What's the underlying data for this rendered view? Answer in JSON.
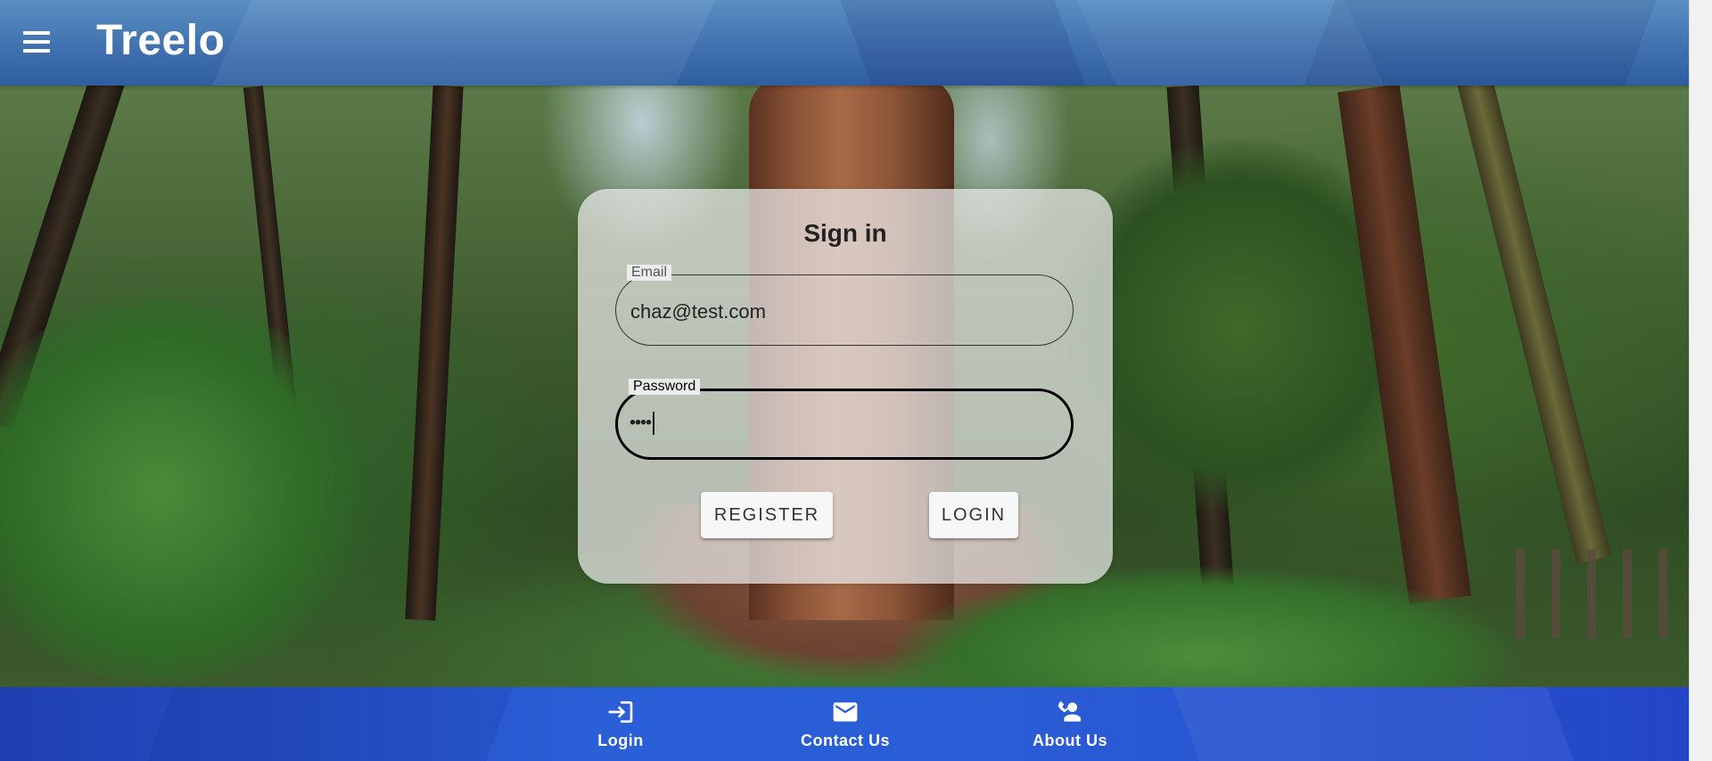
{
  "app": {
    "title": "Treelo"
  },
  "signin": {
    "title": "Sign in",
    "email": {
      "label": "Email",
      "value": "chaz@test.com"
    },
    "password": {
      "label": "Password",
      "value": "••••"
    },
    "register_label": "REGISTER",
    "login_label": "LOGIN"
  },
  "bottom_nav": {
    "items": [
      {
        "label": "Login",
        "icon": "login-icon"
      },
      {
        "label": "Contact Us",
        "icon": "mail-icon"
      },
      {
        "label": "About Us",
        "icon": "contact-phone-icon"
      }
    ]
  },
  "colors": {
    "appbar": "#3f6fae",
    "bottom_nav": "#2b5fd8",
    "card": "#ececec"
  }
}
